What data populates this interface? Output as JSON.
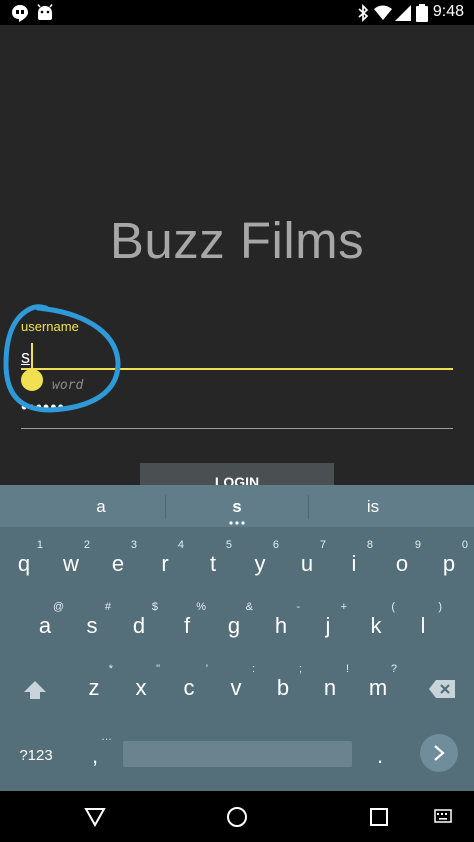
{
  "status_bar": {
    "time": "9:48"
  },
  "app": {
    "title": "Buzz Films",
    "username_label": "username",
    "username_value": "s",
    "password_hint": "word",
    "password_dots": "••••••",
    "login_label": "LOGIN"
  },
  "keyboard": {
    "suggestions": [
      "a",
      "s",
      "is"
    ],
    "row1": [
      {
        "key": "q",
        "hint": "1"
      },
      {
        "key": "w",
        "hint": "2"
      },
      {
        "key": "e",
        "hint": "3"
      },
      {
        "key": "r",
        "hint": "4"
      },
      {
        "key": "t",
        "hint": "5"
      },
      {
        "key": "y",
        "hint": "6"
      },
      {
        "key": "u",
        "hint": "7"
      },
      {
        "key": "i",
        "hint": "8"
      },
      {
        "key": "o",
        "hint": "9"
      },
      {
        "key": "p",
        "hint": "0"
      }
    ],
    "row2": [
      {
        "key": "a",
        "hint": "@"
      },
      {
        "key": "s",
        "hint": "#"
      },
      {
        "key": "d",
        "hint": "$"
      },
      {
        "key": "f",
        "hint": "%"
      },
      {
        "key": "g",
        "hint": "&"
      },
      {
        "key": "h",
        "hint": "-"
      },
      {
        "key": "j",
        "hint": "+"
      },
      {
        "key": "k",
        "hint": "("
      },
      {
        "key": "l",
        "hint": ")"
      }
    ],
    "row3": [
      {
        "key": "z",
        "hint": "*"
      },
      {
        "key": "x",
        "hint": "\""
      },
      {
        "key": "c",
        "hint": "'"
      },
      {
        "key": "v",
        "hint": ":"
      },
      {
        "key": "b",
        "hint": ";"
      },
      {
        "key": "n",
        "hint": "!"
      },
      {
        "key": "m",
        "hint": "?"
      }
    ],
    "symbols_label": "?123",
    "comma": ",",
    "comma_hint": "…",
    "period": "."
  },
  "colors": {
    "accent_yellow": "#f1e152",
    "annotation_blue": "#2f9ad8",
    "keyboard_bg": "#546e7a"
  }
}
